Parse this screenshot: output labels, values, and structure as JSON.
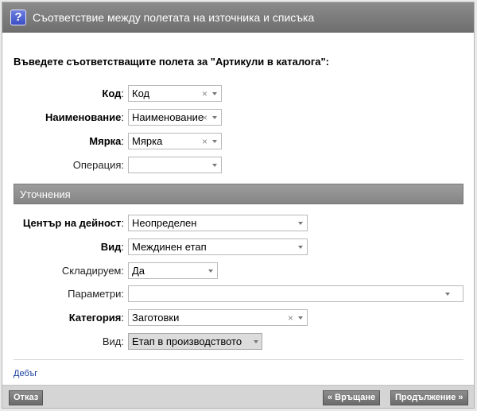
{
  "dialog": {
    "title": "Съответствие между полетата на източника и списъка",
    "help_icon": "question-mark-icon"
  },
  "instruction": "Въведете съответстващите полета за \"Артикули в каталога\":",
  "mapping": [
    {
      "label": "Код",
      "colon": ":",
      "value": "Код"
    },
    {
      "label": "Наименование",
      "colon": ":",
      "value": "Наименование"
    },
    {
      "label": "Мярка",
      "colon": ":",
      "value": "Мярка"
    },
    {
      "label": "Операция",
      "colon": ":",
      "value": ""
    }
  ],
  "section_title": "Уточнения",
  "details": [
    {
      "label": "Център на дейност",
      "colon": ":",
      "value": "Неопределен"
    },
    {
      "label": "Вид",
      "colon": ":",
      "value": "Междинен етап"
    },
    {
      "label": "Складируем",
      "colon": ":",
      "value": "Да"
    },
    {
      "label": "Параметри",
      "colon": ":",
      "value": ""
    },
    {
      "label": "Категория",
      "colon": ":",
      "value": "Заготовки"
    },
    {
      "label": "Вид",
      "colon": ":",
      "value": "Етап в производството"
    }
  ],
  "clear_glyph": "×",
  "debug_link": "Дебъг",
  "buttons": {
    "cancel": "Отказ",
    "back": "« Връщане",
    "next": "Продължение »"
  }
}
